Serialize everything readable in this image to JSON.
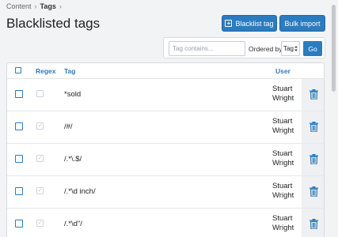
{
  "breadcrumb": {
    "items": [
      "Content",
      "Tags"
    ],
    "separator": "›"
  },
  "page": {
    "title": "Blacklisted tags"
  },
  "toolbar": {
    "blacklist_label": "Blacklist tag",
    "bulk_import_label": "Bulk import"
  },
  "filter": {
    "placeholder": "Tag contains...",
    "ordered_by_label": "Ordered by:",
    "order_value": "Tag",
    "go_label": "Go"
  },
  "table": {
    "headers": {
      "regex": "Regex",
      "tag": "Tag",
      "user": "User"
    },
    "rows": [
      {
        "tag": "*sold",
        "user_line1": "Stuart",
        "user_line2": "Wright",
        "regex": false
      },
      {
        "tag": "/#/",
        "user_line1": "Stuart",
        "user_line2": "Wright",
        "regex": true
      },
      {
        "tag": "/.*\\.$/",
        "user_line1": "Stuart",
        "user_line2": "Wright",
        "regex": true
      },
      {
        "tag": "/.*\\d inch/",
        "user_line1": "Stuart",
        "user_line2": "Wright",
        "regex": true
      },
      {
        "tag": "/.*\\d\"/",
        "user_line1": "Stuart",
        "user_line2": "Wright",
        "regex": true
      }
    ]
  },
  "colors": {
    "accent": "#2b7bbf",
    "background": "#f2f3f5"
  },
  "icons": {
    "delete": "trash-icon",
    "add": "plus-square-icon",
    "sort": "sort-icon"
  }
}
